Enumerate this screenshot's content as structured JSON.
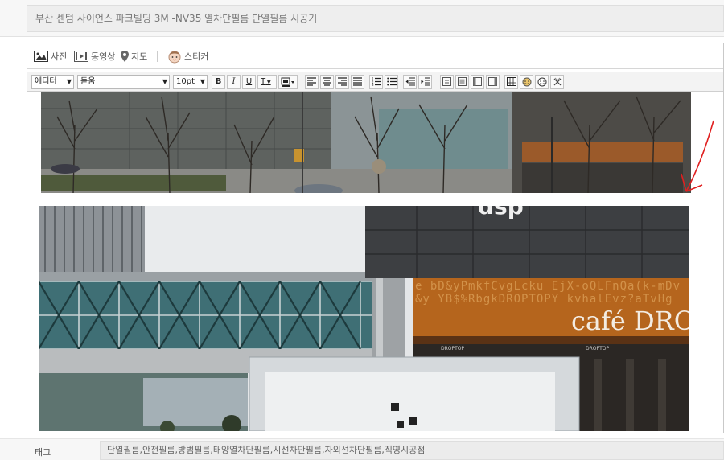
{
  "post": {
    "title": "부산 센텀 사이언스 파크빌딩 3M -NV35 열차단필름 단열필름 시공기"
  },
  "attach": {
    "photo": "사진",
    "video": "동영상",
    "map": "지도",
    "sticker": "스티커"
  },
  "toolbar": {
    "style_select": "에디터",
    "font_select": "돋움",
    "size_select": "10pt",
    "bold": "B",
    "italic": "I",
    "underline": "U",
    "font_color": "T"
  },
  "photo2_sign": {
    "letters": "e bD&yPmkfCvgLcku EjX-oQLFnQa(k-mDv&y YB$%RbgkDROPTOPY kvhalEvz?aTvHg",
    "cafe_text": "café DRO",
    "canopy_left": "DROPTOP",
    "canopy_right": "DROPTOP",
    "top_logo": "dsp"
  },
  "tags": {
    "label": "태그",
    "value": "단열필름,안전필름,방범필름,태양열차단필름,시선차단필름,자외선차단필름,직영시공점"
  },
  "colors": {
    "accent_arrow": "#e02020",
    "cafe_sign": "#b5651d",
    "toolbar_bg": "#f3f3f3"
  }
}
